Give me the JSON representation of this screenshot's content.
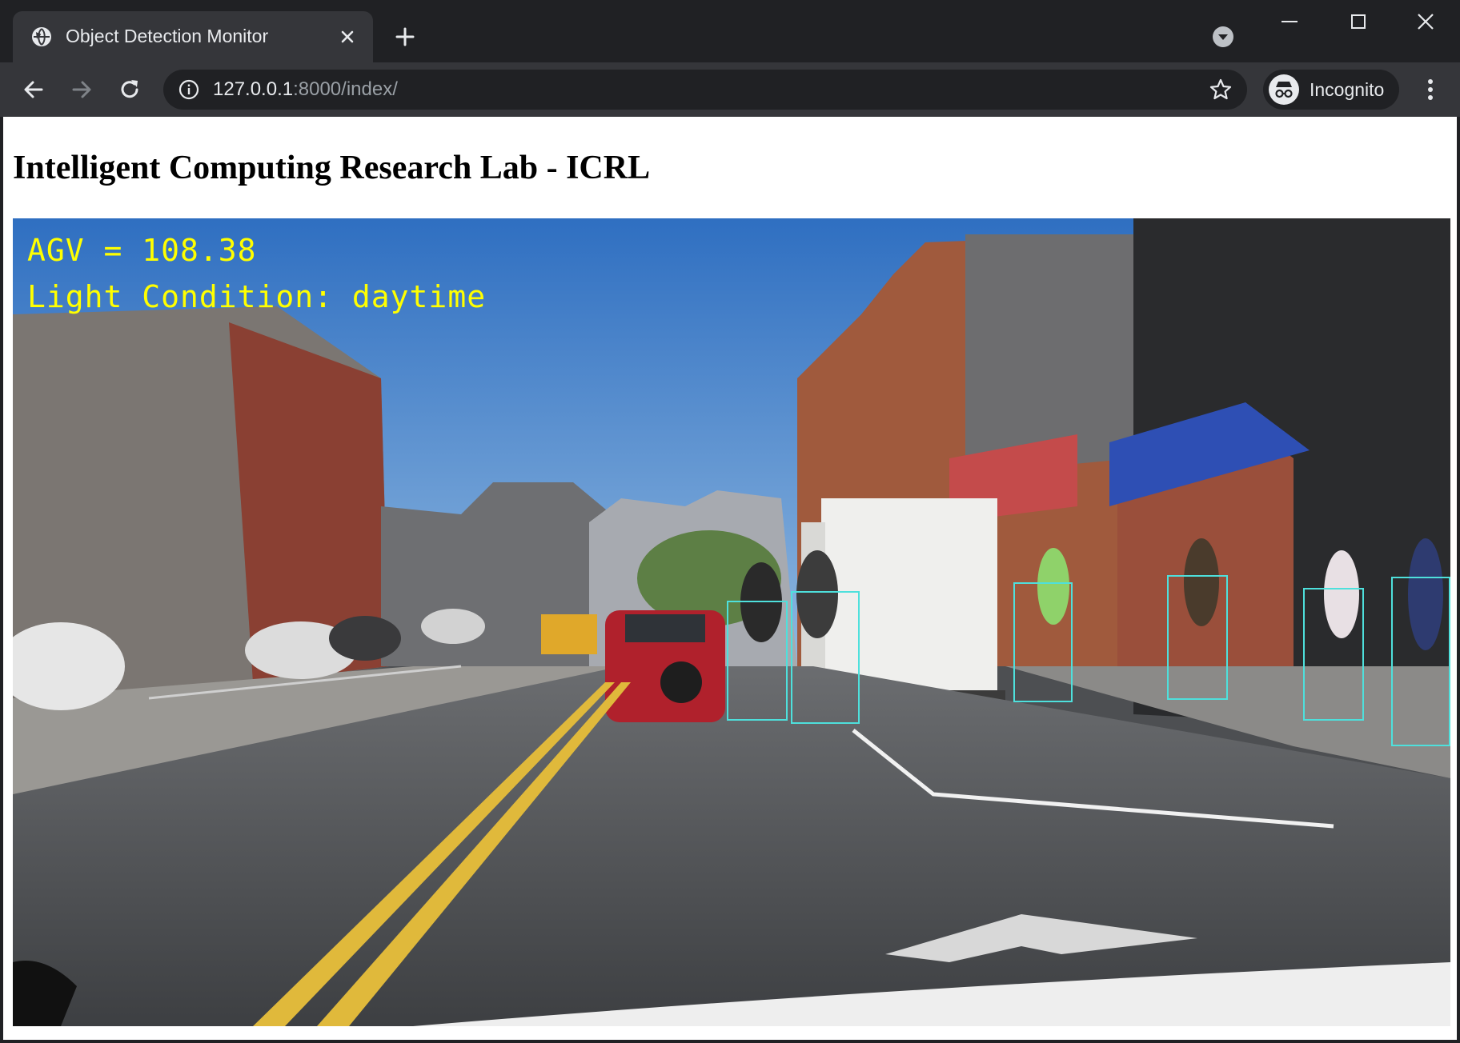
{
  "browser": {
    "tab_title": "Object Detection Monitor",
    "url_host": "127.0.0.1",
    "url_rest": ":8000/index/",
    "profile_label": "Incognito"
  },
  "page": {
    "title": "Intelligent Computing Research Lab - ICRL"
  },
  "video": {
    "overlay_agv": "AGV = 108.38",
    "overlay_light": "Light Condition: daytime",
    "detection_color": "#4ee0dc",
    "overlay_color": "#ffff00"
  }
}
